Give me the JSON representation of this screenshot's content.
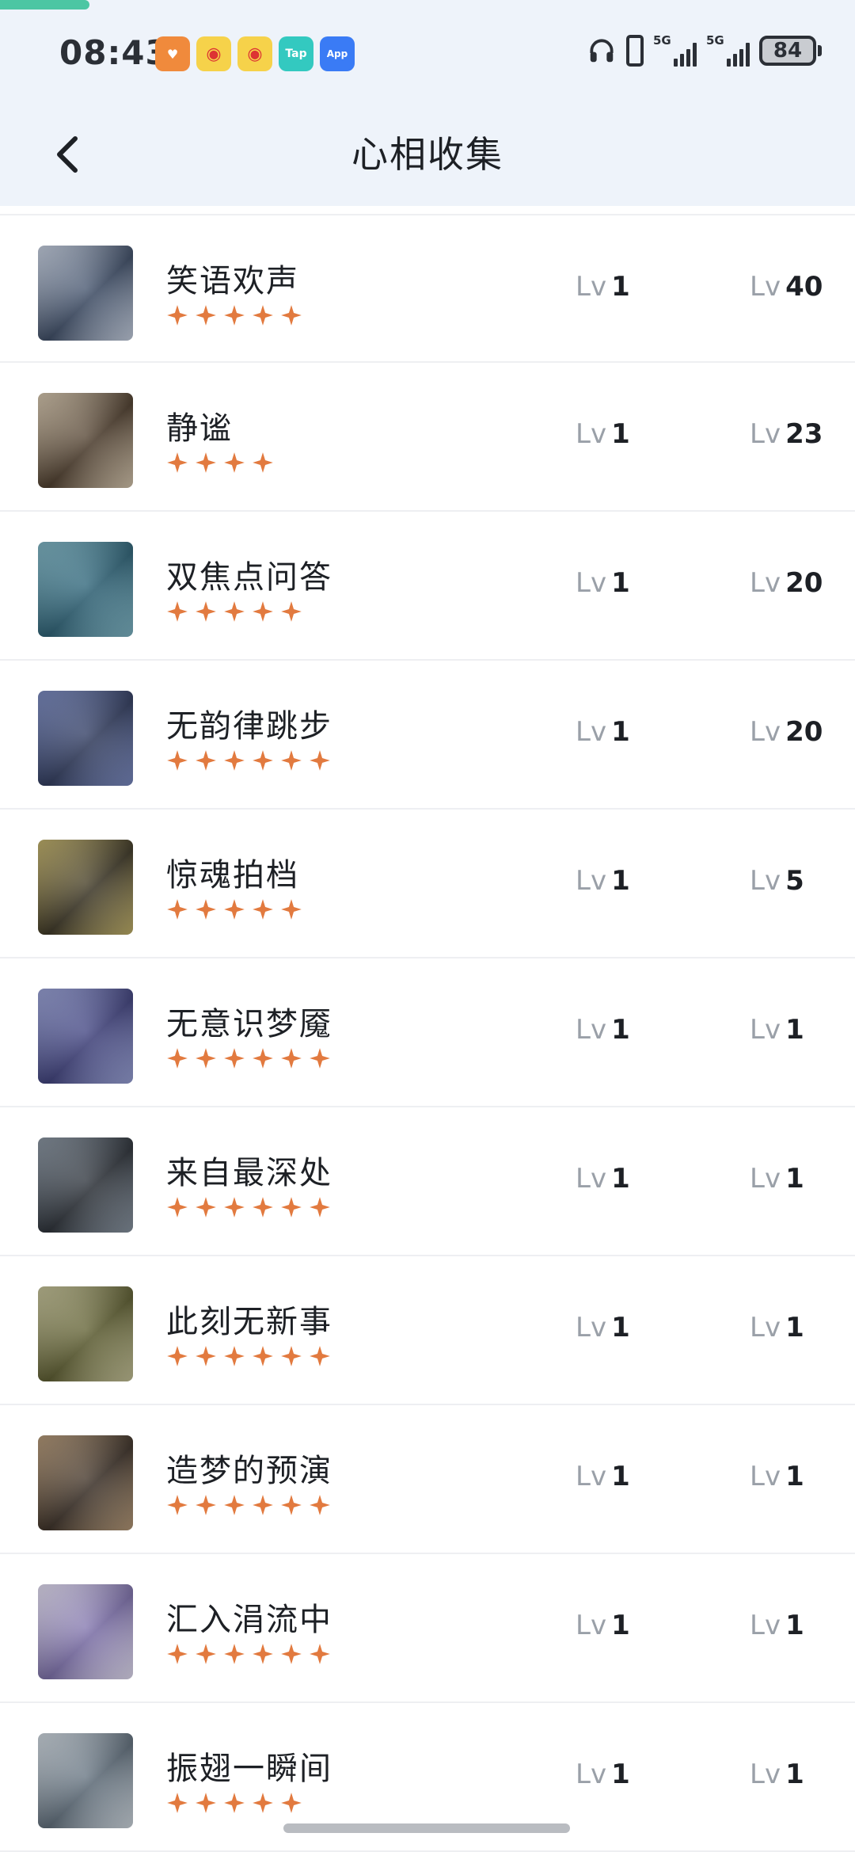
{
  "status_bar": {
    "time": "08:43",
    "apps": [
      {
        "icon": "heart-app-icon",
        "glyph": "♥"
      },
      {
        "icon": "weibo-app-icon",
        "glyph": "◉"
      },
      {
        "icon": "weibo-app-icon",
        "glyph": "◉"
      },
      {
        "icon": "tap-app-icon",
        "glyph": "Tap"
      },
      {
        "icon": "app-market-icon",
        "glyph": "App"
      }
    ],
    "network_1": "5G",
    "network_2": "5G",
    "battery": "84"
  },
  "header": {
    "title": "心相收集",
    "back_icon": "chevron-left-icon"
  },
  "list": {
    "lv_prefix": "Lv",
    "items": [
      {
        "name": "笑语欢声",
        "stars": 5,
        "lv_current": "1",
        "lv_max": "40",
        "avatar_colors": [
          "#3b4a63",
          "#c9d3e4"
        ]
      },
      {
        "name": "静谧",
        "stars": 4,
        "lv_current": "1",
        "lv_max": "23",
        "avatar_colors": [
          "#4a3a2a",
          "#d9c9b0"
        ]
      },
      {
        "name": "双焦点问答",
        "stars": 5,
        "lv_current": "1",
        "lv_max": "20",
        "avatar_colors": [
          "#2b5f73",
          "#7fb7c7"
        ]
      },
      {
        "name": "无韵律跳步",
        "stars": 6,
        "lv_current": "1",
        "lv_max": "20",
        "avatar_colors": [
          "#2f3a5c",
          "#7a8ac2"
        ]
      },
      {
        "name": "惊魂拍档",
        "stars": 5,
        "lv_current": "1",
        "lv_max": "5",
        "avatar_colors": [
          "#3b3524",
          "#c4b36a"
        ]
      },
      {
        "name": "无意识梦魇",
        "stars": 6,
        "lv_current": "1",
        "lv_max": "1",
        "avatar_colors": [
          "#3d3f7a",
          "#9aa3d9"
        ]
      },
      {
        "name": "来自最深处",
        "stars": 6,
        "lv_current": "1",
        "lv_max": "1",
        "avatar_colors": [
          "#2a2f36",
          "#8a96a3"
        ]
      },
      {
        "name": "此刻无新事",
        "stars": 6,
        "lv_current": "1",
        "lv_max": "1",
        "avatar_colors": [
          "#5a5a2e",
          "#c8c59a"
        ]
      },
      {
        "name": "造梦的预演",
        "stars": 6,
        "lv_current": "1",
        "lv_max": "1",
        "avatar_colors": [
          "#3a2f26",
          "#b79a78"
        ]
      },
      {
        "name": "汇入涓流中",
        "stars": 6,
        "lv_current": "1",
        "lv_max": "1",
        "avatar_colors": [
          "#7b6ea8",
          "#e6e1f5"
        ]
      },
      {
        "name": "振翅一瞬间",
        "stars": 5,
        "lv_current": "1",
        "lv_max": "1",
        "avatar_colors": [
          "#5d6b78",
          "#d2dbe3"
        ]
      }
    ]
  },
  "colors": {
    "star": "#e27a3f",
    "accent": "#4cc6a3",
    "header_bg": "#eef3fa"
  }
}
